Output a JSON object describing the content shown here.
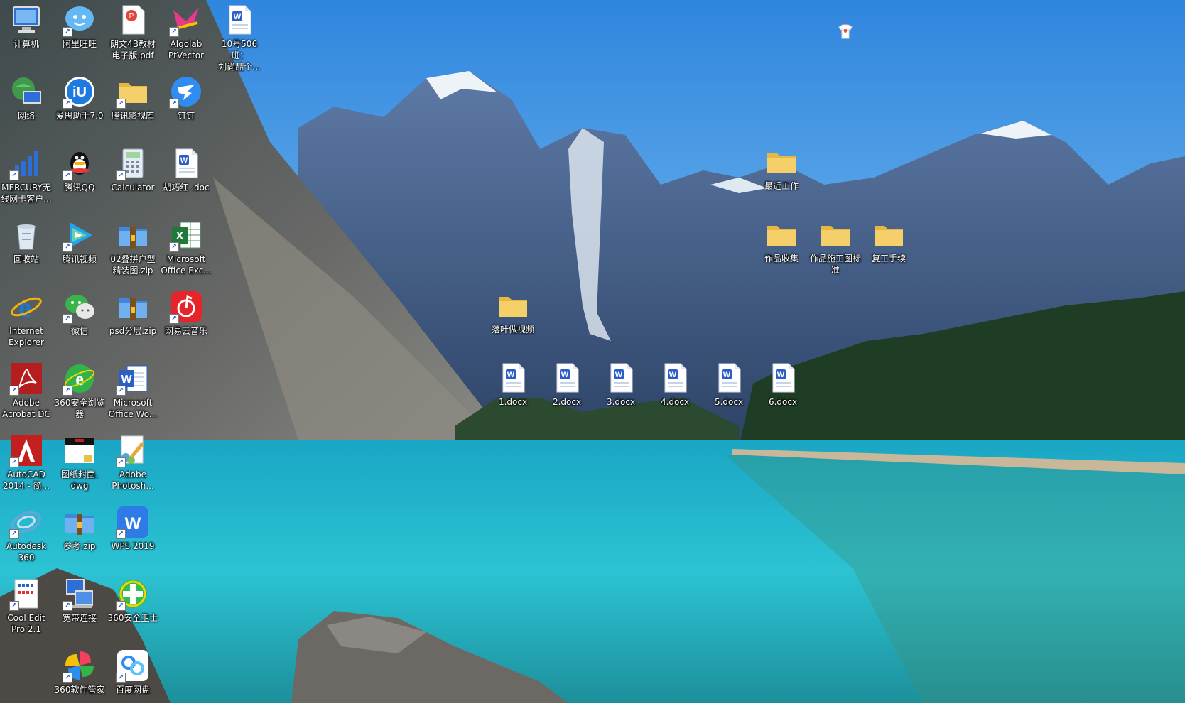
{
  "desktop": {
    "left_icons": [
      {
        "label": "计算机",
        "icon": "computer-icon",
        "shortcut": false
      },
      {
        "label": "阿里旺旺",
        "icon": "aliwangwang-icon",
        "shortcut": true
      },
      {
        "label": "朗文4B教材\n电子版.pdf",
        "icon": "pdf-file-icon",
        "shortcut": false
      },
      {
        "label": "Algolab\nPtVector",
        "icon": "algolab-icon",
        "shortcut": true
      },
      {
        "label": "10号506班：\n刘尚喆个...",
        "icon": "word-doc-icon",
        "shortcut": false
      },
      {
        "label": "网络",
        "icon": "network-icon",
        "shortcut": false
      },
      {
        "label": "爱思助手7.0",
        "icon": "aisi-icon",
        "shortcut": true
      },
      {
        "label": "腾讯影视库",
        "icon": "folder-icon",
        "shortcut": true
      },
      {
        "label": "钉钉",
        "icon": "dingtalk-icon",
        "shortcut": true
      },
      {
        "label": "MERCURY无\n线网卡客户...",
        "icon": "mercury-icon",
        "shortcut": true
      },
      {
        "label": "腾讯QQ",
        "icon": "qq-icon",
        "shortcut": true
      },
      {
        "label": "Calculator",
        "icon": "calculator-icon",
        "shortcut": true
      },
      {
        "label": "胡巧红 .doc",
        "icon": "word-doc-icon",
        "shortcut": false
      },
      {
        "label": "回收站",
        "icon": "recycle-bin-icon",
        "shortcut": false
      },
      {
        "label": "腾讯视频",
        "icon": "tencent-video-icon",
        "shortcut": true
      },
      {
        "label": "02叠拼户型\n精装图.zip",
        "icon": "zip-archive-icon",
        "shortcut": false
      },
      {
        "label": "Microsoft\nOffice Exc...",
        "icon": "excel-icon",
        "shortcut": true
      },
      {
        "label": "Internet\nExplorer",
        "icon": "ie-icon",
        "shortcut": false
      },
      {
        "label": "微信",
        "icon": "wechat-icon",
        "shortcut": true
      },
      {
        "label": "psd分层.zip",
        "icon": "zip-archive-icon",
        "shortcut": false
      },
      {
        "label": "网易云音乐",
        "icon": "netease-music-icon",
        "shortcut": true
      },
      {
        "label": "Adobe\nAcrobat DC",
        "icon": "acrobat-icon",
        "shortcut": true
      },
      {
        "label": "360安全浏览\n器",
        "icon": "360-browser-icon",
        "shortcut": true
      },
      {
        "label": "Microsoft\nOffice Wo...",
        "icon": "word-app-icon",
        "shortcut": true
      },
      {
        "label": "AutoCAD\n2014 - 简...",
        "icon": "autocad-icon",
        "shortcut": true
      },
      {
        "label": "图纸封面.\ndwg",
        "icon": "dwg-file-icon",
        "shortcut": false
      },
      {
        "label": "Adobe\nPhotosh...",
        "icon": "photoshop-icon",
        "shortcut": true
      },
      {
        "label": "Autodesk\n360",
        "icon": "autodesk-icon",
        "shortcut": true
      },
      {
        "label": "参考.zip",
        "icon": "zip-archive-icon",
        "shortcut": false
      },
      {
        "label": "WPS 2019",
        "icon": "wps-icon",
        "shortcut": true
      },
      {
        "label": "Cool Edit\nPro 2.1",
        "icon": "cool-edit-icon",
        "shortcut": true
      },
      {
        "label": "宽带连接",
        "icon": "broadband-icon",
        "shortcut": true
      },
      {
        "label": "360安全卫士",
        "icon": "360-guard-icon",
        "shortcut": true
      },
      {
        "label": "360软件管家",
        "icon": "360-software-icon",
        "shortcut": true
      },
      {
        "label": "百度网盘",
        "icon": "baidu-netdisk-icon",
        "shortcut": true
      }
    ],
    "right_icons": [
      {
        "label": "最近工作",
        "icon": "folder-icon"
      },
      {
        "label": "作品收集",
        "icon": "folder-icon"
      },
      {
        "label": "作品施工图标\n准",
        "icon": "folder-icon"
      },
      {
        "label": "复工手续",
        "icon": "folder-icon"
      },
      {
        "label": "落叶做视频",
        "icon": "folder-icon"
      },
      {
        "label": "1.docx",
        "icon": "word-doc-icon"
      },
      {
        "label": "2.docx",
        "icon": "word-doc-icon"
      },
      {
        "label": "3.docx",
        "icon": "word-doc-icon"
      },
      {
        "label": "4.docx",
        "icon": "word-doc-icon"
      },
      {
        "label": "5.docx",
        "icon": "word-doc-icon"
      },
      {
        "label": "6.docx",
        "icon": "word-doc-icon"
      }
    ],
    "top_ornament": {
      "icon": "tshirt-heart-icon"
    }
  },
  "colors": {
    "sky": "#3a8ee0",
    "lake": "#1fb4c9",
    "folder": "#f2cf5b",
    "word": "#2b5fc7"
  }
}
